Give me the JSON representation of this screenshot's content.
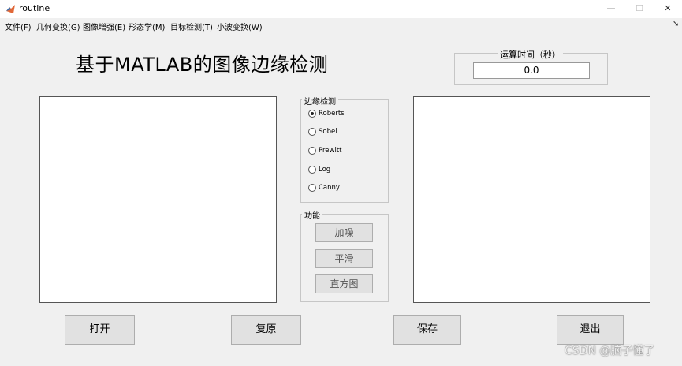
{
  "window": {
    "title": "routine",
    "controls": {
      "minimize": "—",
      "maximize": "☐",
      "close": "✕"
    },
    "icon": "matlab-logo-icon"
  },
  "menubar": {
    "items": [
      {
        "label": "文件(F)"
      },
      {
        "label": "几何变换(G)"
      },
      {
        "label": "图像增强(E)"
      },
      {
        "label": "形态学(M)"
      },
      {
        "label": "目标检测(T)"
      },
      {
        "label": "小波变换(W)"
      }
    ],
    "overflow_icon": "arrow-icon"
  },
  "main": {
    "title": "基于MATLAB的图像边缘检测"
  },
  "timing": {
    "legend": "运算时间（秒）",
    "value": "0.0"
  },
  "edge_detection": {
    "legend": "边缘检测",
    "options": [
      {
        "label": "Roberts",
        "checked": true
      },
      {
        "label": "Sobel",
        "checked": false
      },
      {
        "label": "Prewitt",
        "checked": false
      },
      {
        "label": "Log",
        "checked": false
      },
      {
        "label": "Canny",
        "checked": false
      }
    ]
  },
  "functions": {
    "legend": "功能",
    "buttons": [
      {
        "label": "加噪"
      },
      {
        "label": "平滑"
      },
      {
        "label": "直方图"
      }
    ]
  },
  "actions": {
    "open": "打开",
    "restore": "复原",
    "save": "保存",
    "exit": "退出"
  },
  "watermark": "CSDN @脑子懂了"
}
